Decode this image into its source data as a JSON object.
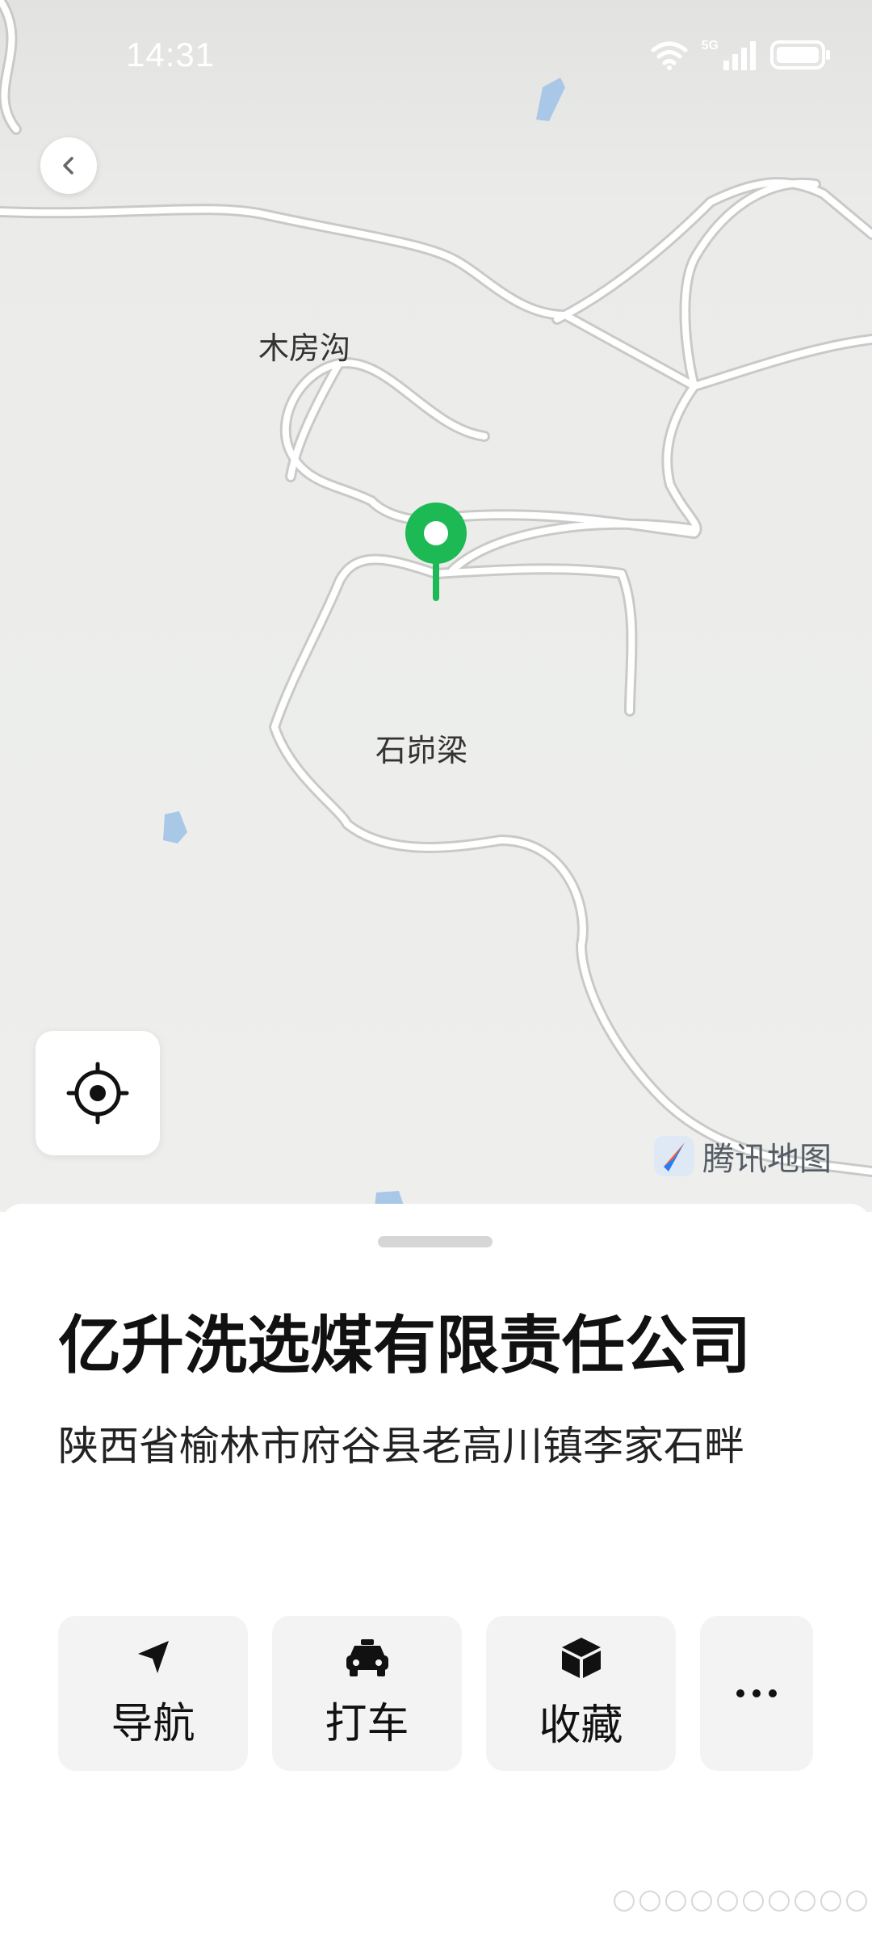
{
  "status_bar": {
    "time": "14:31",
    "network": "5G"
  },
  "map": {
    "labels": [
      "木房沟",
      "石峁梁"
    ],
    "brand": "腾讯地图",
    "colors": {
      "background": "#eeefed",
      "road": "#ffffff",
      "water": "#a9c7e6",
      "pin": "#1db954"
    }
  },
  "place": {
    "title": "亿升洗选煤有限责任公司",
    "address": "陕西省榆林市府谷县老高川镇李家石畔"
  },
  "actions": [
    {
      "label": "导航",
      "icon": "navigate-arrow-icon"
    },
    {
      "label": "打车",
      "icon": "taxi-icon"
    },
    {
      "label": "收藏",
      "icon": "box-icon"
    },
    {
      "label": "",
      "icon": "more-dots-icon"
    }
  ]
}
